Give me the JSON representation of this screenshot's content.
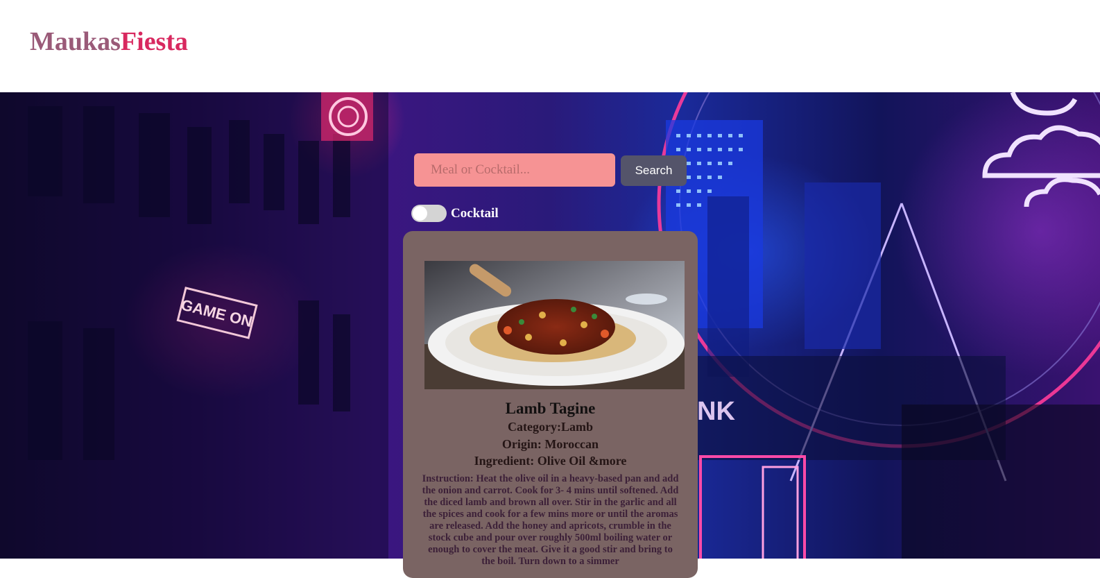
{
  "header": {
    "logo_part1": "Maukas",
    "logo_part2": "Fiesta"
  },
  "search": {
    "placeholder": "Meal or Cocktail...",
    "button_label": "Search"
  },
  "toggle": {
    "label": "Cocktail",
    "checked": false
  },
  "meal": {
    "title": "Lamb Tagine",
    "category": "Category:Lamb",
    "origin": "Origin: Moroccan",
    "ingredient": "Ingredient: Olive Oil &more",
    "instruction": "Instruction: Heat the olive oil in a heavy-based pan and add the onion and carrot. Cook for 3- 4 mins until softened. Add the diced lamb and brown all over. Stir in the garlic and all the spices and cook for a few mins more or until the aromas are released. Add the honey and apricots, crumble in the stock cube and pour over roughly 500ml boiling water or enough to cover the meat. Give it a good stir and bring to the boil. Turn down to a simmer"
  },
  "background_signs": {
    "left_sign": "GAME ON",
    "right_sign": "NK"
  }
}
